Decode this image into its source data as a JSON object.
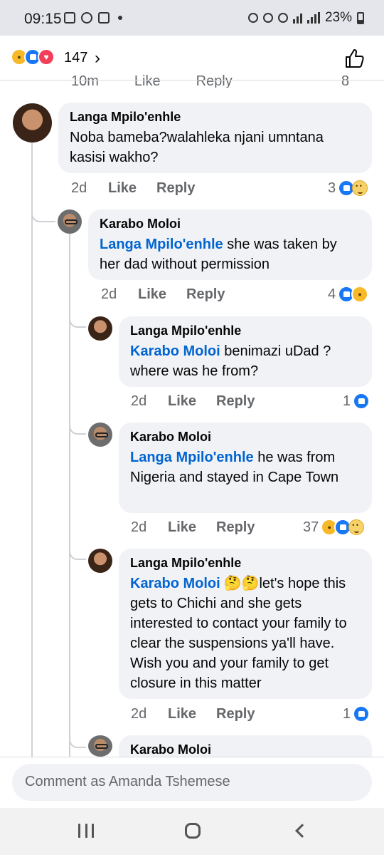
{
  "status_bar": {
    "time": "09:15",
    "battery": "23%"
  },
  "header": {
    "reaction_count": "147",
    "reactions": [
      "wow-icon",
      "like-icon",
      "love-icon"
    ],
    "chevron": "›"
  },
  "cut_off_row": {
    "time": "10m",
    "like": "Like",
    "reply": "Reply",
    "count": "8"
  },
  "comments": [
    {
      "author": "Langa Mpilo'enhle",
      "mention": "",
      "text": "Noba bameba?walahleka njani umntana kasisi wakho?",
      "time": "2d",
      "like": "Like",
      "reply": "Reply",
      "reaction_count": "3"
    },
    {
      "author": "Karabo Moloi",
      "mention": "Langa Mpilo'enhle",
      "text": " she was taken by her dad without permission",
      "time": "2d",
      "like": "Like",
      "reply": "Reply",
      "reaction_count": "4"
    },
    {
      "author": "Langa Mpilo'enhle",
      "mention": "Karabo Moloi",
      "text": " benimazi uDad ? where was he from?",
      "time": "2d",
      "like": "Like",
      "reply": "Reply",
      "reaction_count": "1"
    },
    {
      "author": "Karabo Moloi",
      "mention": "Langa Mpilo'enhle",
      "text": " he was from Nigeria and stayed in Cape Town",
      "time": "2d",
      "like": "Like",
      "reply": "Reply",
      "reaction_count": "37"
    },
    {
      "author": "Langa Mpilo'enhle",
      "mention": "Karabo Moloi",
      "emoji": "🤔🤔",
      "text": "let's hope this gets to Chichi and she gets interested to contact your family to clear the suspensions ya'll have. Wish you and your family to get closure in this matter",
      "time": "2d",
      "like": "Like",
      "reply": "Reply",
      "reaction_count": "1"
    },
    {
      "author": "Karabo Moloi"
    }
  ],
  "composer": {
    "placeholder": "Comment as Amanda Tshemese"
  }
}
